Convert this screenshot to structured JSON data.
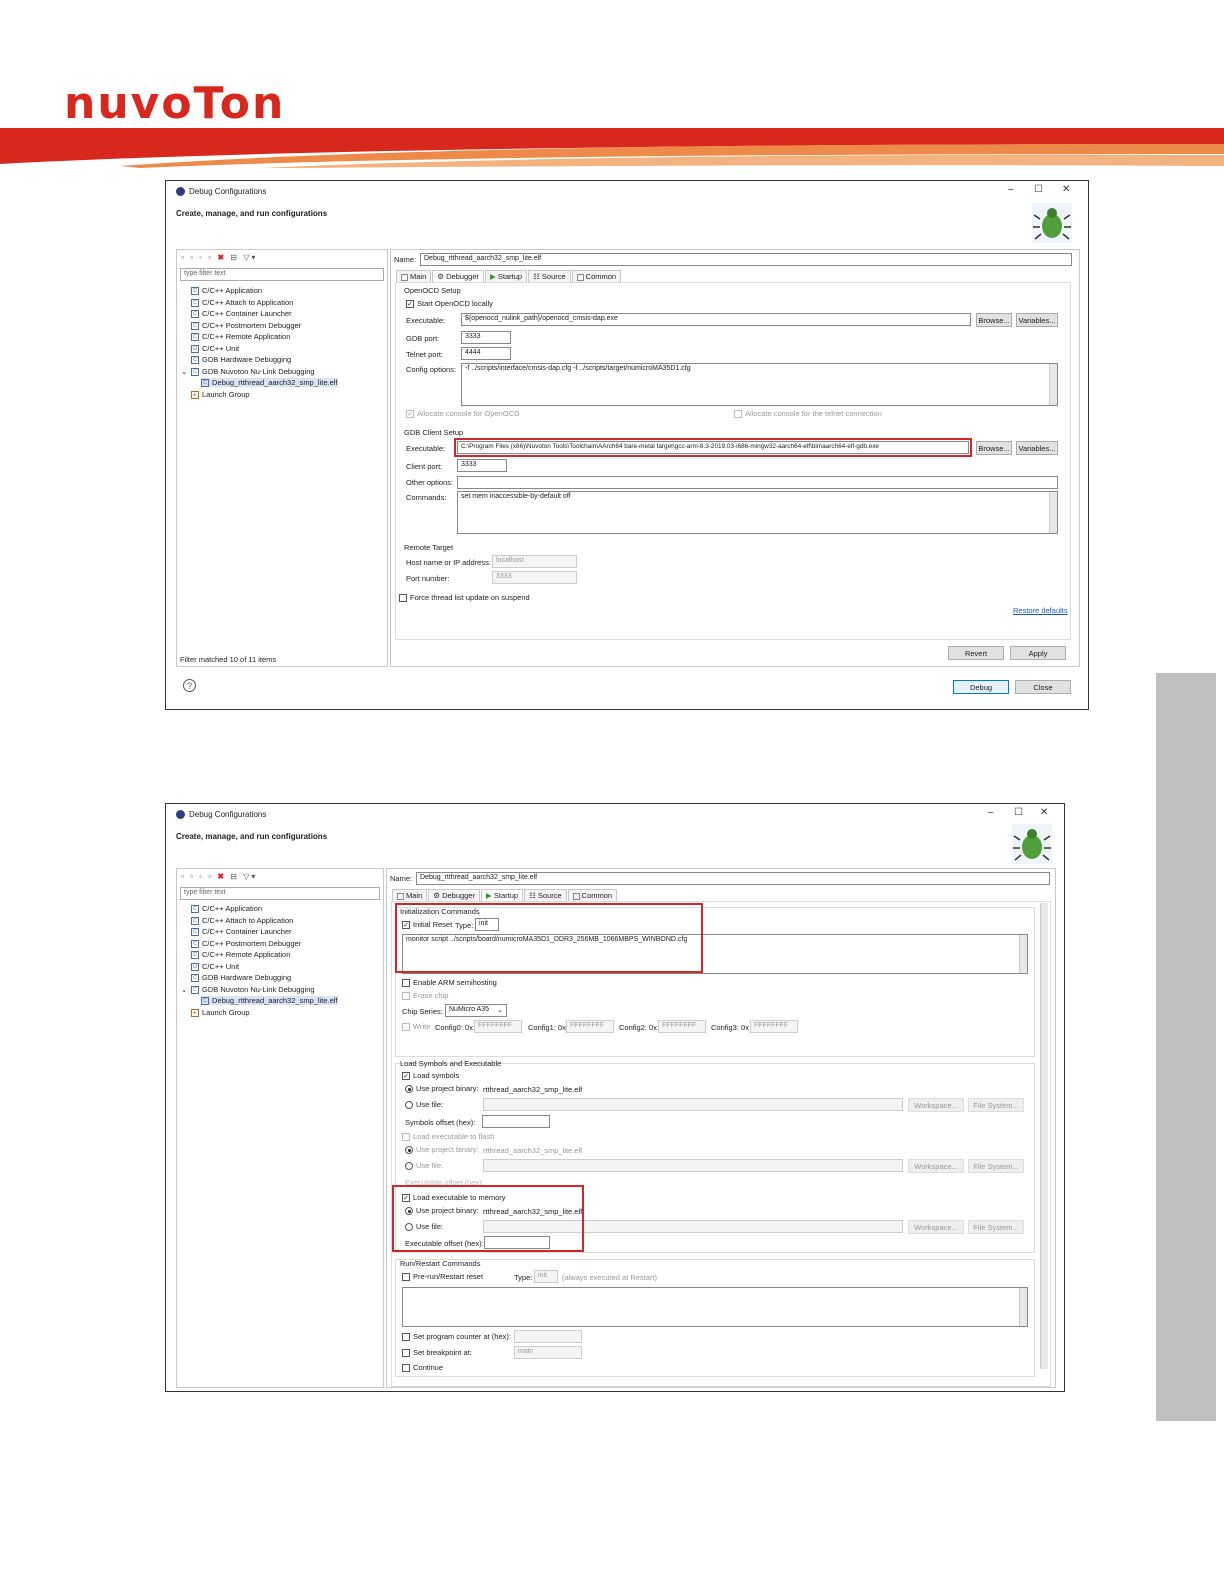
{
  "brand": {
    "name": "nuvoTon"
  },
  "dialog1": {
    "title": "Debug Configurations",
    "heading": "Create, manage, and run configurations",
    "filter_placeholder": "type filter text",
    "tree": [
      "C/C++ Application",
      "C/C++ Attach to Application",
      "C/C++ Container Launcher",
      "C/C++ Postmortem Debugger",
      "C/C++ Remote Application",
      "C/C++ Unit",
      "GDB Hardware Debugging",
      "GDB Nuvoton Nu-Link Debugging",
      "Debug_rtthread_aarch32_smp_lite.elf",
      "Launch Group"
    ],
    "filter_status": "Filter matched 10 of 11 items",
    "name_label": "Name:",
    "name_value": "Debug_rtthread_aarch32_smp_lite.elf",
    "tabs": [
      "Main",
      "Debugger",
      "Startup",
      "Source",
      "Common"
    ],
    "openocd": {
      "group": "OpenOCD Setup",
      "start_locally": "Start OpenOCD locally",
      "exec_label": "Executable:",
      "exec_value": "${openocd_nulink_path}/openocd_cmsis-dap.exe",
      "gdb_port_label": "GDB port:",
      "gdb_port": "3333",
      "telnet_label": "Telnet port:",
      "telnet_port": "4444",
      "config_label": "Config options:",
      "config_value": "-f ../scripts/interface/cmsis-dap.cfg -f ../scripts/target/numicroMA35D1.cfg",
      "alloc_console": "Allocate console for OpenOCD",
      "alloc_telnet": "Allocate console for the telnet connection"
    },
    "gdb_client": {
      "group": "GDB Client Setup",
      "exec_label": "Executable:",
      "exec_value": "C:\\Program Files (x86)\\Nuvoton Tools\\Toolchain\\AArch64 bare-metal target\\gcc-arm-8.3-2019.03-i686-mingw32-aarch64-elf\\bin\\aarch64-elf-gdb.exe",
      "port_label": "Client port:",
      "port": "3333",
      "other_label": "Other options:",
      "commands_label": "Commands:",
      "commands_value": "set mem inaccessible-by-default off"
    },
    "remote": {
      "group": "Remote Target",
      "host_label": "Host name or IP address:",
      "host": "localhost",
      "port_label": "Port number:",
      "port": "3333"
    },
    "force_thread": "Force thread list update on suspend",
    "restore": "Restore defaults",
    "browse": "Browse...",
    "variables": "Variables...",
    "revert": "Revert",
    "apply": "Apply",
    "debug": "Debug",
    "close": "Close"
  },
  "dialog2": {
    "title": "Debug Configurations",
    "heading": "Create, manage, and run configurations",
    "filter_placeholder": "type filter text",
    "name_label": "Name:",
    "name_value": "Debug_rtthread_aarch32_smp_lite.elf",
    "tabs": [
      "Main",
      "Debugger",
      "Startup",
      "Source",
      "Common"
    ],
    "init": {
      "group": "Initialization Commands",
      "initial_reset": "Initial Reset",
      "type_label": "Type:",
      "type_value": "init",
      "commands": "monitor script ../scripts/board/numicroMA35D1_DDR3_256MB_1066MBPS_WINBOND.cfg"
    },
    "semihosting": "Enable ARM semihosting",
    "erase": "Erase chip",
    "chip_label": "Chip Series:",
    "chip_value": "NuMicro A35",
    "write": "Write",
    "config0_label": "Config0: 0x",
    "config0": "FFFFFFFF",
    "config1_label": "Config1: 0x",
    "config1": "FFFFFFFF",
    "config2_label": "Config2: 0x",
    "config2": "FFFFFFFF",
    "config3_label": "Config3: 0x",
    "config3": "FFFFFFFF",
    "load": {
      "group": "Load Symbols and Executable",
      "load_symbols": "Load symbols",
      "use_project_binary": "Use project binary:",
      "binary": "rtthread_aarch32_smp_lite.elf",
      "use_file": "Use file:",
      "symbols_offset": "Symbols offset (hex):",
      "load_flash": "Load executable to flash",
      "exec_offset_dis": "Executable offset (hex):",
      "load_memory": "Load executable to memory",
      "exec_offset": "Executable offset (hex):",
      "workspace": "Workspace...",
      "file_system": "File System..."
    },
    "run": {
      "group": "Run/Restart Commands",
      "pre_run": "Pre-run/Restart reset",
      "type_label": "Type:",
      "type_value": "init",
      "always": "(always executed at Restart)",
      "set_pc": "Set program counter at (hex):",
      "set_bp": "Set breakpoint at:",
      "bp_value": "main",
      "continue": "Continue"
    }
  }
}
